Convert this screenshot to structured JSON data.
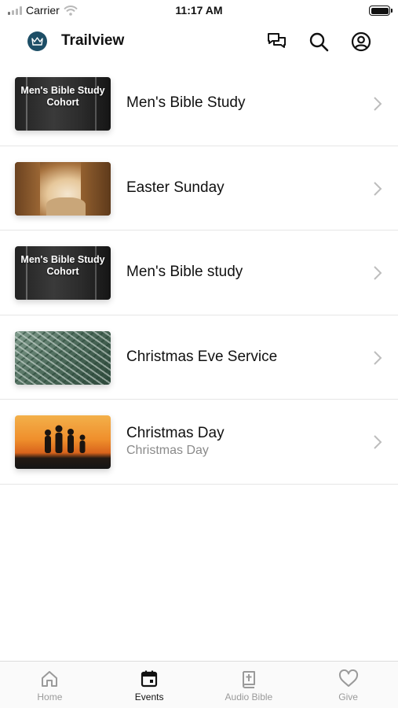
{
  "status_bar": {
    "carrier": "Carrier",
    "time": "11:17 AM"
  },
  "header": {
    "title": "Trailview"
  },
  "events": [
    {
      "title": "Men's Bible Study",
      "subtitle": "",
      "thumb_text": "Men's Bible Study Cohort",
      "thumb": "dark-cohort"
    },
    {
      "title": "Easter Sunday",
      "subtitle": "",
      "thumb_text": "",
      "thumb": "tomb"
    },
    {
      "title": "Men's Bible study",
      "subtitle": "",
      "thumb_text": "Men's Bible Study Cohort",
      "thumb": "dark-cohort"
    },
    {
      "title": "Christmas Eve Service",
      "subtitle": "",
      "thumb_text": "",
      "thumb": "pine"
    },
    {
      "title": "Christmas Day",
      "subtitle": "Christmas Day",
      "thumb_text": "",
      "thumb": "sunset"
    }
  ],
  "tabs": [
    {
      "label": "Home",
      "icon": "home-icon",
      "active": false
    },
    {
      "label": "Events",
      "icon": "calendar-icon",
      "active": true
    },
    {
      "label": "Audio Bible",
      "icon": "bible-icon",
      "active": false
    },
    {
      "label": "Give",
      "icon": "heart-icon",
      "active": false
    }
  ],
  "colors": {
    "accent": "#111111",
    "inactive_tab": "#9a9a9a",
    "logo_bg": "#1d4e66",
    "divider": "#e6e6e6"
  }
}
